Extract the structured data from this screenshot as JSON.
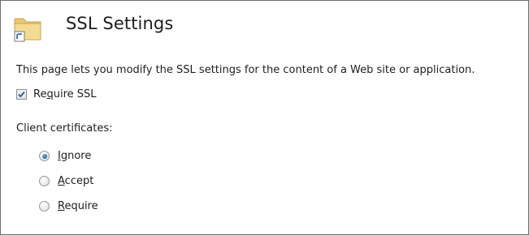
{
  "header": {
    "title": "SSL Settings",
    "icon": "folder-shortcut-icon"
  },
  "description": "This page lets you modify the SSL settings for the content of a Web site or application.",
  "require_ssl": {
    "label_prefix": "Re",
    "label_accel": "q",
    "label_suffix": "uire SSL",
    "checked": true
  },
  "client_certificates": {
    "label": "Client certificates:",
    "options": [
      {
        "accel": "I",
        "rest": "gnore",
        "selected": true
      },
      {
        "accel": "A",
        "rest": "ccept",
        "selected": false
      },
      {
        "accel": "R",
        "rest": "equire",
        "selected": false
      }
    ]
  },
  "colors": {
    "border": "#6e6e6e",
    "check_mark": "#2a5ea8",
    "radio_dot": "#2a6fb0"
  }
}
